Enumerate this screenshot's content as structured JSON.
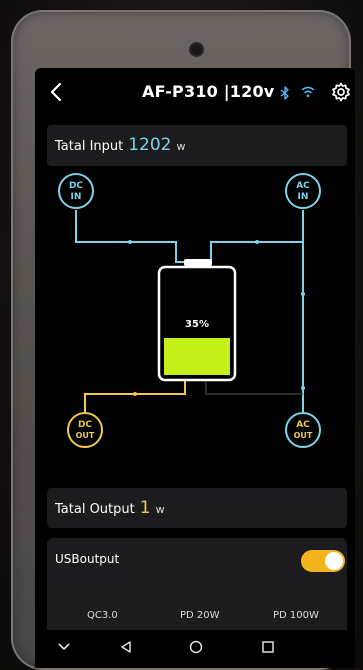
{
  "header": {
    "title": "AF-P310 |120v",
    "icons": [
      "back-arrow-icon",
      "bluetooth-icon",
      "wifi-icon",
      "gear-icon"
    ]
  },
  "input": {
    "label": "Tatal Input",
    "value": "1202",
    "unit": "w"
  },
  "diagram": {
    "battery_percent_text": "35%",
    "battery_level": 0.35,
    "nodes": {
      "dc_in": {
        "line1": "DC",
        "line2": "IN"
      },
      "ac_in": {
        "line1": "AC",
        "line2": "IN"
      },
      "dc_out": {
        "line1": "DC",
        "line2": "OUT"
      },
      "ac_out": {
        "line1": "AC",
        "line2": "OUT"
      }
    }
  },
  "output": {
    "label": "Tatal Output",
    "value": "1",
    "unit": "w"
  },
  "usb": {
    "title": "USBoutput",
    "toggle_on": true,
    "ports": [
      "QC3.0",
      "PD 20W",
      "PD 100W"
    ]
  },
  "colors": {
    "input_accent": "#7fd3e8",
    "output_accent": "#f2c94c",
    "battery_fill": "#c5f019",
    "toggle": "#f2b31d"
  },
  "navbar": {
    "icons": [
      "chevron-down-icon",
      "back-triangle-icon",
      "home-circle-icon",
      "recents-square-icon"
    ]
  }
}
